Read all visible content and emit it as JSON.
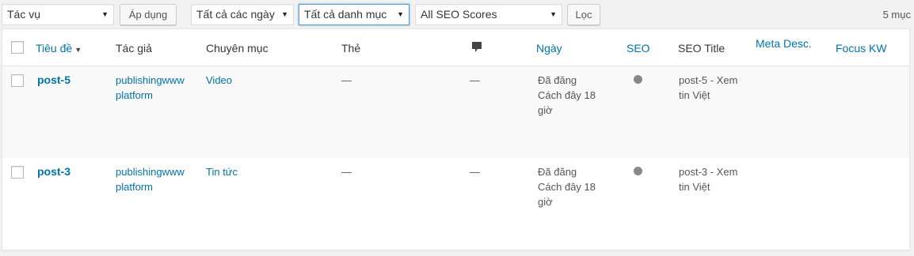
{
  "toolbar": {
    "bulk_action": "Tác vụ",
    "apply_label": "Áp dụng",
    "date_filter": "Tất cả các ngày",
    "category_filter": "Tất cả danh mục",
    "seo_filter": "All SEO Scores",
    "filter_label": "Lọc",
    "item_count": "5 mục"
  },
  "columns": {
    "title": "Tiêu đề",
    "author": "Tác giả",
    "category": "Chuyên mục",
    "tags": "Thẻ",
    "date": "Ngày",
    "seo": "SEO",
    "seo_title": "SEO Title",
    "meta_desc": "Meta Desc.",
    "focus_kw": "Focus KW"
  },
  "icons": {
    "comments": "comment-bubble-icon",
    "sort": "sort-down-icon",
    "dropdown": "chevron-down-icon"
  },
  "colors": {
    "link": "#0073aa",
    "seo_dot": "#888888"
  },
  "rows": [
    {
      "title": "post-5",
      "author_line1": "publishingwww",
      "author_line2": "platform",
      "category": "Video",
      "tags": "—",
      "comments": "—",
      "date_line1": "Đã đăng",
      "date_line2": "Cách đây 18",
      "date_line3": "giờ",
      "seo_title_line1": "post-5 - Xem",
      "seo_title_line2": "tin Việt"
    },
    {
      "title": "post-3",
      "author_line1": "publishingwww",
      "author_line2": "platform",
      "category": "Tin tức",
      "tags": "—",
      "comments": "—",
      "date_line1": "Đã đăng",
      "date_line2": "Cách đây 18",
      "date_line3": "giờ",
      "seo_title_line1": "post-3 - Xem",
      "seo_title_line2": "tin Việt"
    }
  ]
}
